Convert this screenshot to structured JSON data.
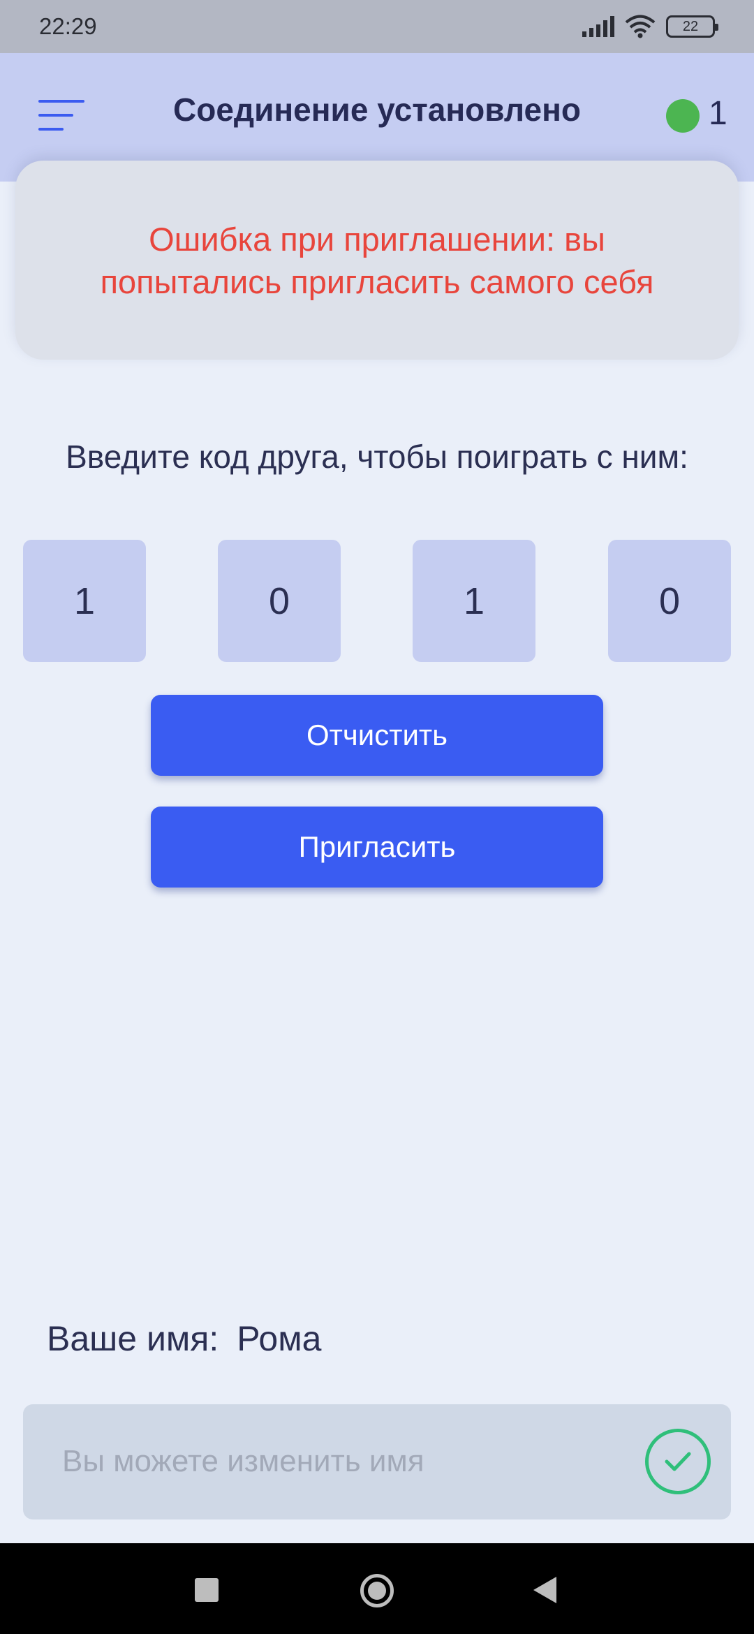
{
  "status_bar": {
    "time": "22:29",
    "battery": "22",
    "icons": [
      "signal-icon",
      "wifi-icon",
      "battery-icon"
    ]
  },
  "header": {
    "title": "Соединение установлено",
    "online_count": "1",
    "online_color": "#4cb551",
    "menu_icon": "menu-icon"
  },
  "error": {
    "message": "Ошибка при приглашении: вы попытались пригласить самого себя",
    "color": "#e8453c"
  },
  "invite": {
    "prompt": "Введите код друга, чтобы поиграть с ним:",
    "code": [
      "1",
      "0",
      "1",
      "0"
    ],
    "clear_label": "Отчистить",
    "invite_label": "Пригласить",
    "button_color": "#3a5cf2"
  },
  "profile": {
    "name_label": "Ваше имя:",
    "name_value": "Рома",
    "name_placeholder": "Вы можете изменить имя",
    "confirm_icon": "check-icon",
    "confirm_color": "#2fbf7a"
  },
  "nav_bar": {
    "icons": [
      "recent-apps-icon",
      "home-icon",
      "back-icon"
    ]
  }
}
